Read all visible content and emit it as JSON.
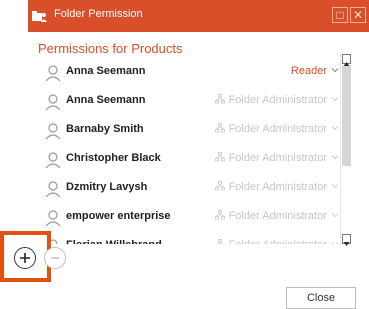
{
  "window": {
    "title": "Folder Permission",
    "colors": {
      "accent": "#d94f2a",
      "highlight": "#e2520f",
      "muted": "#c6c6c6"
    }
  },
  "section_title": "Permissions for Products",
  "permissions": [
    {
      "name": "Anna Seemann",
      "role": "Reader",
      "editable": true,
      "icon": "user-icon"
    },
    {
      "name": "Anna Seemann",
      "role": "Folder Administrator",
      "editable": false,
      "icon": "user-icon"
    },
    {
      "name": "Barnaby Smith",
      "role": "Folder Administrator",
      "editable": false,
      "icon": "user-icon"
    },
    {
      "name": "Christopher Black",
      "role": "Folder Administrator",
      "editable": false,
      "icon": "user-icon"
    },
    {
      "name": "Dzmitry Lavysh",
      "role": "Folder Administrator",
      "editable": false,
      "icon": "user-icon"
    },
    {
      "name": "empower enterprise",
      "role": "Folder Administrator",
      "editable": false,
      "icon": "user-icon"
    },
    {
      "name": "Florian Willebrand",
      "role": "Folder Administrator",
      "editable": false,
      "icon": "user-icon"
    }
  ],
  "buttons": {
    "add_icon": "plus-icon",
    "remove_icon": "minus-icon",
    "close_label": "Close"
  }
}
